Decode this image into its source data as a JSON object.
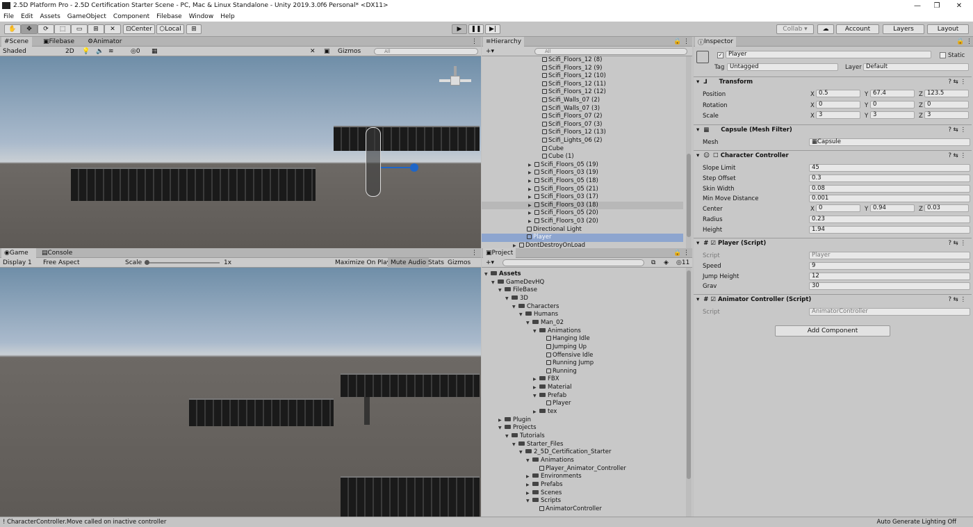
{
  "window": {
    "title": "2.5D Platform Pro - 2.5D Certification Starter Scene - PC, Mac & Linux Standalone - Unity 2019.3.0f6 Personal* <DX11>",
    "min": "—",
    "max": "❐",
    "close": "✕"
  },
  "menu": [
    "File",
    "Edit",
    "Assets",
    "GameObject",
    "Component",
    "Filebase",
    "Window",
    "Help"
  ],
  "toolbar": {
    "center": "Center",
    "local": "Local",
    "collab": "Collab ▾",
    "account": "Account",
    "layers": "Layers",
    "layout": "Layout"
  },
  "scene": {
    "tabs": [
      "Scene",
      "Filebase",
      "Animator"
    ],
    "shading": "Shaded",
    "mode2d": "2D",
    "fxcount": "0",
    "gizmos": "Gizmos",
    "search": "All"
  },
  "game": {
    "tabs": [
      "Game",
      "Console"
    ],
    "display": "Display 1",
    "aspect": "Free Aspect",
    "scale_label": "Scale",
    "scale_value": "1x",
    "maximize": "Maximize On Play",
    "mute": "Mute Audio",
    "stats": "Stats",
    "gizmos": "Gizmos"
  },
  "hierarchy": {
    "tab": "Hierarchy",
    "search": "All",
    "items": [
      {
        "label": "Scifi_Floors_12 (8)",
        "depth": 2,
        "arrow": false
      },
      {
        "label": "Scifi_Floors_12 (9)",
        "depth": 2,
        "arrow": false
      },
      {
        "label": "Scifi_Floors_12 (10)",
        "depth": 2,
        "arrow": false
      },
      {
        "label": "Scifi_Floors_12 (11)",
        "depth": 2,
        "arrow": false
      },
      {
        "label": "Scifi_Floors_12 (12)",
        "depth": 2,
        "arrow": false
      },
      {
        "label": "Scifi_Walls_07 (2)",
        "depth": 2,
        "arrow": false
      },
      {
        "label": "Scifi_Walls_07 (3)",
        "depth": 2,
        "arrow": false
      },
      {
        "label": "Scifi_Floors_07 (2)",
        "depth": 2,
        "arrow": false
      },
      {
        "label": "Scifi_Floors_07 (3)",
        "depth": 2,
        "arrow": false
      },
      {
        "label": "Scifi_Floors_12 (13)",
        "depth": 2,
        "arrow": false
      },
      {
        "label": "Scifi_Lights_06 (2)",
        "depth": 2,
        "arrow": false
      },
      {
        "label": "Cube",
        "depth": 2,
        "arrow": false
      },
      {
        "label": "Cube (1)",
        "depth": 2,
        "arrow": false
      },
      {
        "label": "Scifi_Floors_05 (19)",
        "depth": 1,
        "arrow": true
      },
      {
        "label": "Scifi_Floors_03 (19)",
        "depth": 1,
        "arrow": true
      },
      {
        "label": "Scifi_Floors_05 (18)",
        "depth": 1,
        "arrow": true
      },
      {
        "label": "Scifi_Floors_05 (21)",
        "depth": 1,
        "arrow": true
      },
      {
        "label": "Scifi_Floors_03 (17)",
        "depth": 1,
        "arrow": true
      },
      {
        "label": "Scifi_Floors_03 (18)",
        "depth": 1,
        "arrow": true,
        "hover": true
      },
      {
        "label": "Scifi_Floors_05 (20)",
        "depth": 1,
        "arrow": true
      },
      {
        "label": "Scifi_Floors_03 (20)",
        "depth": 1,
        "arrow": true
      },
      {
        "label": "Directional Light",
        "depth": 0,
        "arrow": false
      },
      {
        "label": "Player",
        "depth": 0,
        "arrow": false,
        "selected": true
      },
      {
        "label": "DontDestroyOnLoad",
        "depth": -1,
        "arrow": true
      }
    ]
  },
  "project": {
    "tab": "Project",
    "count": "11",
    "items": [
      {
        "label": "Assets",
        "depth": 0,
        "open": true,
        "bold": true
      },
      {
        "label": "GameDevHQ",
        "depth": 1,
        "open": true
      },
      {
        "label": "FileBase",
        "depth": 2,
        "open": true
      },
      {
        "label": "3D",
        "depth": 3,
        "open": true
      },
      {
        "label": "Characters",
        "depth": 4,
        "open": true
      },
      {
        "label": "Humans",
        "depth": 5,
        "open": true
      },
      {
        "label": "Man_02",
        "depth": 6,
        "open": true
      },
      {
        "label": "Animations",
        "depth": 7,
        "open": true
      },
      {
        "label": "Hanging Idle",
        "depth": 8,
        "leaf": true
      },
      {
        "label": "Jumping Up",
        "depth": 8,
        "leaf": true
      },
      {
        "label": "Offensive Idle",
        "depth": 8,
        "leaf": true
      },
      {
        "label": "Running Jump",
        "depth": 8,
        "leaf": true
      },
      {
        "label": "Running",
        "depth": 8,
        "leaf": true
      },
      {
        "label": "FBX",
        "depth": 7,
        "open": false
      },
      {
        "label": "Material",
        "depth": 7,
        "open": false
      },
      {
        "label": "Prefab",
        "depth": 7,
        "open": true
      },
      {
        "label": "Player",
        "depth": 8,
        "leaf": true
      },
      {
        "label": "tex",
        "depth": 7,
        "open": false
      },
      {
        "label": "Plugin",
        "depth": 2,
        "open": false
      },
      {
        "label": "Projects",
        "depth": 2,
        "open": true
      },
      {
        "label": "Tutorials",
        "depth": 3,
        "open": true
      },
      {
        "label": "Starter_Files",
        "depth": 4,
        "open": true
      },
      {
        "label": "2_5D_Certification_Starter",
        "depth": 5,
        "open": true
      },
      {
        "label": "Animations",
        "depth": 6,
        "open": true
      },
      {
        "label": "Player_Animator_Controller",
        "depth": 7,
        "leaf": true
      },
      {
        "label": "Environments",
        "depth": 6,
        "open": false
      },
      {
        "label": "Prefabs",
        "depth": 6,
        "open": false
      },
      {
        "label": "Scenes",
        "depth": 6,
        "open": false
      },
      {
        "label": "Scripts",
        "depth": 6,
        "open": true
      },
      {
        "label": "AnimatorController",
        "depth": 7,
        "leaf": true
      }
    ]
  },
  "inspector": {
    "tab": "Inspector",
    "name": "Player",
    "static": "Static",
    "tag_label": "Tag",
    "tag": "Untagged",
    "layer_label": "Layer",
    "layer": "Default",
    "transform": {
      "title": "Transform",
      "position_label": "Position",
      "rotation_label": "Rotation",
      "scale_label": "Scale",
      "position": [
        "0.5",
        "67.4",
        "123.5"
      ],
      "rotation": [
        "0",
        "0",
        "0"
      ],
      "scale": [
        "3",
        "3",
        "3"
      ]
    },
    "meshfilter": {
      "title": "Capsule (Mesh Filter)",
      "mesh_label": "Mesh",
      "mesh": "Capsule"
    },
    "cc": {
      "title": "Character Controller",
      "slope_label": "Slope Limit",
      "slope": "45",
      "step_label": "Step Offset",
      "step": "0.3",
      "skin_label": "Skin Width",
      "skin": "0.08",
      "minmove_label": "Min Move Distance",
      "minmove": "0.001",
      "center_label": "Center",
      "center": [
        "0",
        "0.94",
        "0.03"
      ],
      "radius_label": "Radius",
      "radius": "0.23",
      "height_label": "Height",
      "height": "1.94"
    },
    "player": {
      "title": "Player (Script)",
      "script_label": "Script",
      "script": "Player",
      "speed_label": "Speed",
      "speed": "9",
      "jump_label": "Jump Height",
      "jump": "12",
      "grav_label": "Grav",
      "grav": "30"
    },
    "animctrl": {
      "title": "Animator Controller (Script)",
      "script_label": "Script",
      "script": "AnimatorController"
    },
    "add": "Add Component"
  },
  "status": {
    "message": "CharacterController.Move called on inactive controller",
    "right": "Auto Generate Lighting Off"
  }
}
